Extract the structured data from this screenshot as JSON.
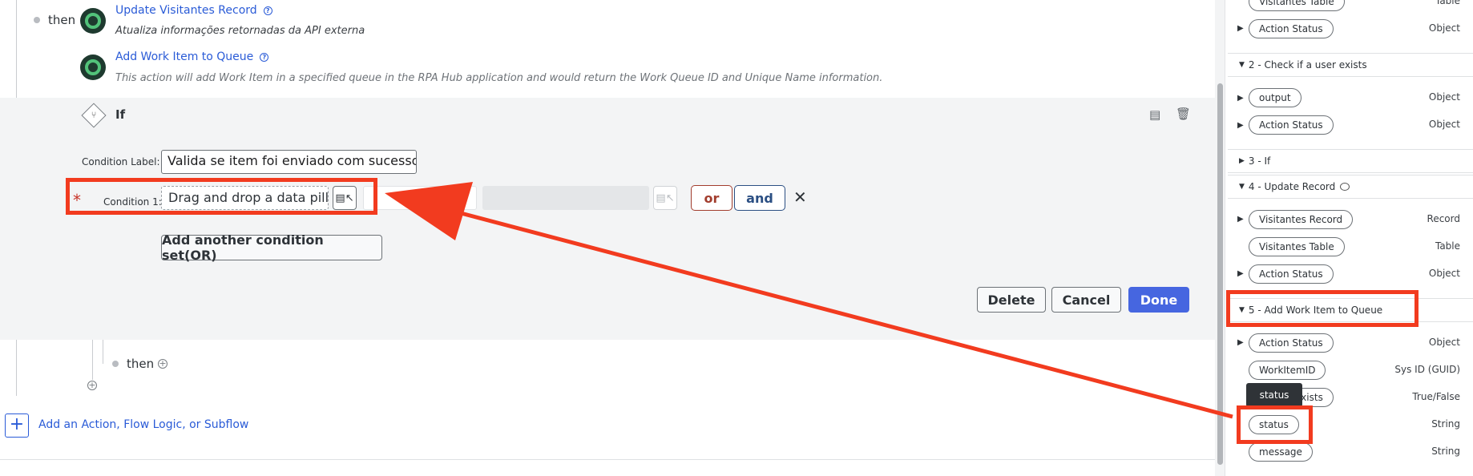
{
  "flow": {
    "then_label": "then",
    "step_update": {
      "title": "Update Visitantes Record",
      "description": "Atualiza informações retornadas da API externa"
    },
    "step_add_work": {
      "title": "Add Work Item to Queue",
      "description": "This action will add Work Item in a specified queue in the RPA Hub application and would return the Work Queue ID and Unique Name information."
    },
    "if_block": {
      "label": "If",
      "condition_label_caption": "Condition Label:",
      "condition_label_value": "Valida se item foi enviado com sucesso p",
      "condition_1_caption": "Condition 1:",
      "condition_1_placeholder": "Drag and drop a data pill i",
      "or_label": "or",
      "and_label": "and",
      "add_condition_set_label": "Add another condition set(OR)",
      "delete_label": "Delete",
      "cancel_label": "Cancel",
      "done_label": "Done"
    },
    "then_label_inner": "then",
    "add_action_label": "Add an Action, Flow Logic, or Subflow"
  },
  "data_panel": {
    "top_pill": "Visitantes Table",
    "top_pill_type": "Table",
    "top_action_status": "Action Status",
    "top_action_status_type": "Object",
    "section_2": {
      "title": "2 - Check if a user exists",
      "rows": [
        {
          "label": "output",
          "type": "Object"
        },
        {
          "label": "Action Status",
          "type": "Object"
        }
      ]
    },
    "section_3": {
      "title": "3 - If"
    },
    "section_4": {
      "title": "4 - Update Record",
      "rows": [
        {
          "label": "Visitantes Record",
          "type": "Record"
        },
        {
          "label": "Visitantes Table",
          "type": "Table"
        },
        {
          "label": "Action Status",
          "type": "Object"
        }
      ]
    },
    "section_5": {
      "title": "5 - Add Work Item to Queue",
      "rows": [
        {
          "label": "Action Status",
          "type": "Object"
        },
        {
          "label": "WorkItemID",
          "type": "Sys ID (GUID)"
        },
        {
          "label": "exists",
          "type": "True/False"
        },
        {
          "label": "status",
          "type": "String"
        },
        {
          "label": "message",
          "type": "String"
        }
      ]
    },
    "tooltip": "status"
  },
  "colors": {
    "annotation": "#f23b1f",
    "link": "#2a5bd7",
    "primary_button": "#4666e0",
    "or_button": "#a23d2e",
    "and_button": "#2b4f83"
  }
}
